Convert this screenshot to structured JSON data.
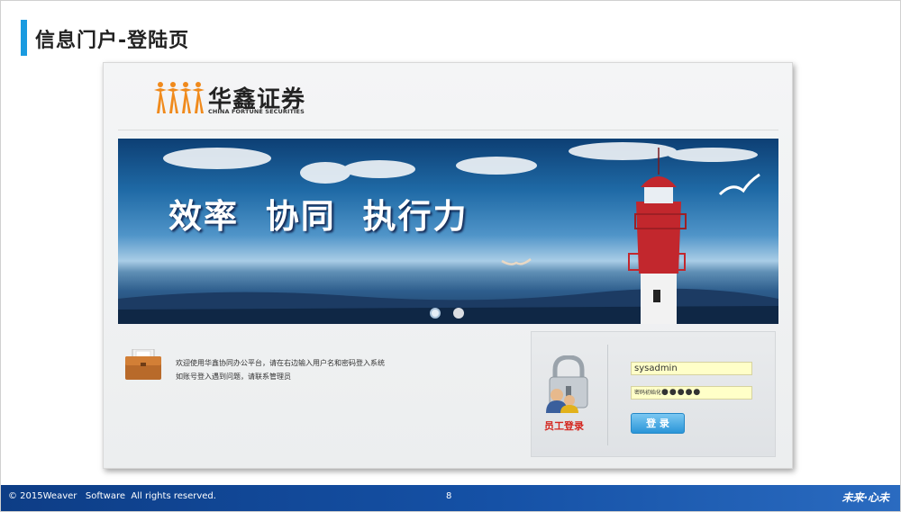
{
  "slide": {
    "title": "信息门户-登陆页",
    "accent_color": "#1a9be0"
  },
  "logo": {
    "icon": "four-figures-logo-icon",
    "name_cn": "华鑫证券",
    "name_en": "CHINA FORTUNE SECURITIES",
    "color": "#f08a1c"
  },
  "banner": {
    "slogan": "效率  协同  执行力",
    "pager_dots": 2
  },
  "welcome": {
    "icon": "briefcase-icon",
    "line1": "欢迎使用华鑫协同办公平台，请在右边输入用户名和密码登入系统",
    "line2": "如账号登入遇到问题，请联系管理员"
  },
  "login": {
    "icon": "padlock-users-icon",
    "title": "员工登录",
    "title_color": "#d4261f",
    "username": "sysadmin",
    "password_hint_top": "######",
    "password_hint_bottom": "密码初始化",
    "password_mask": "●●●●●",
    "submit_label": "登 录"
  },
  "footer": {
    "copyright": "© 2015Weaver   Software  All rights reserved.",
    "page": "8",
    "brand": "未来·心未",
    "color": "#1551a6"
  }
}
